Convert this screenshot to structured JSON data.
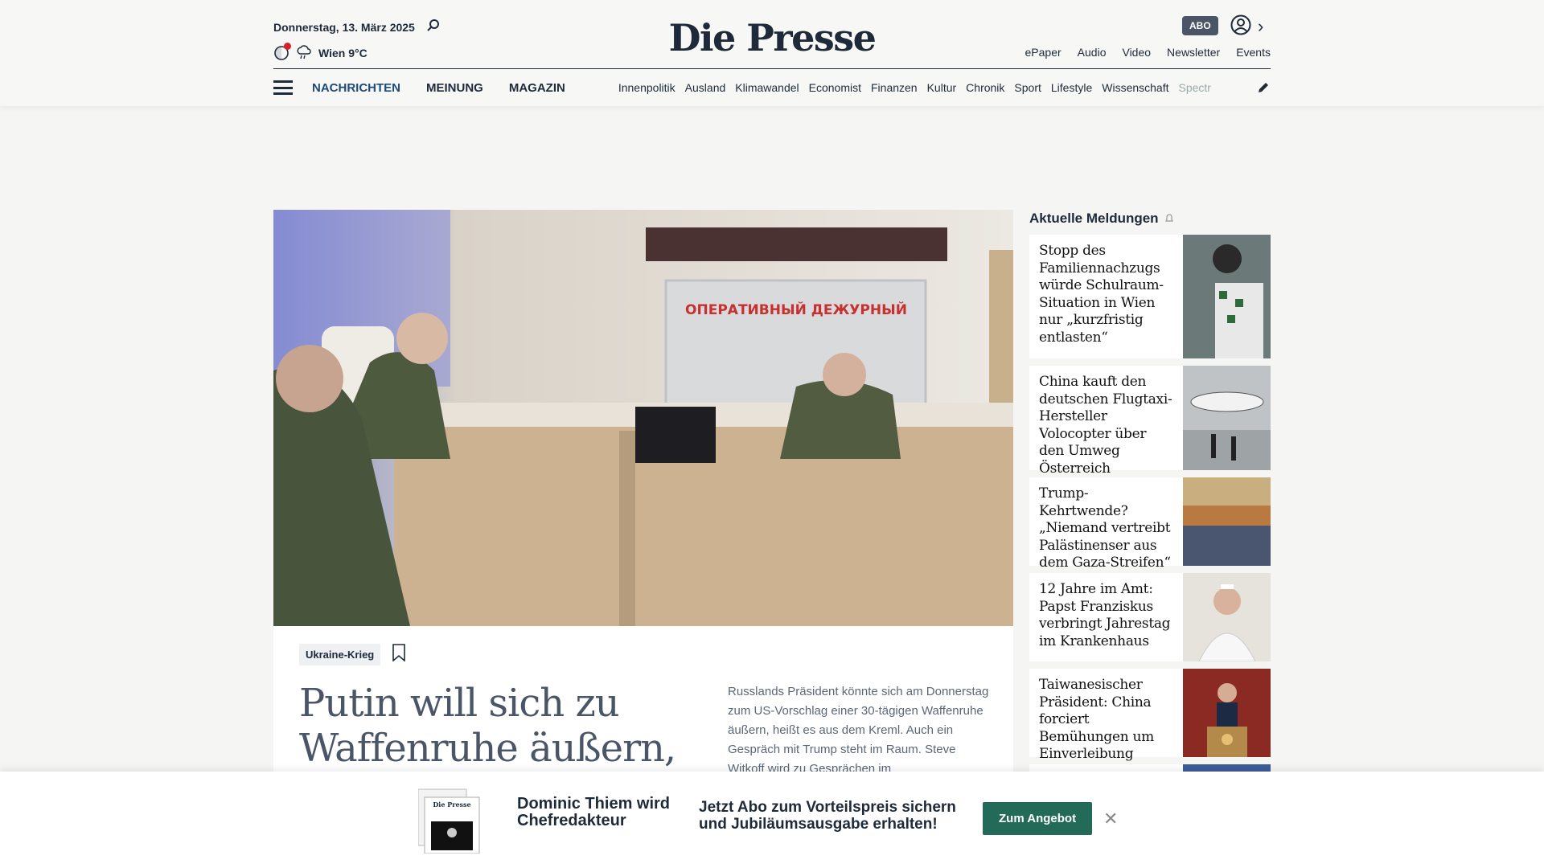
{
  "header": {
    "date": "Donnerstag, 13. März 2025",
    "weather": "Wien 9°C",
    "logo": "Die Presse",
    "abo_label": "ABO",
    "top_links": [
      "ePaper",
      "Audio",
      "Video",
      "Newsletter",
      "Events"
    ]
  },
  "nav": {
    "main": [
      "NACHRICHTEN",
      "MEINUNG",
      "MAGAZIN"
    ],
    "sub": [
      "Innenpolitik",
      "Ausland",
      "Klimawandel",
      "Economist",
      "Finanzen",
      "Kultur",
      "Chronik",
      "Sport",
      "Lifestyle",
      "Wissenschaft",
      "Spectr"
    ]
  },
  "article": {
    "tag": "Ukraine-Krieg",
    "headline": "Putin will sich zu Waffenruhe äußern, US-",
    "lead": "Russlands Präsident könnte sich am Donnerstag zum US-Vorschlag einer 30-tägigen Waffenruhe äußern, heißt es aus dem Kreml. Auch ein Gespräch mit Trump steht im Raum. Steve Witkoff wird zu Gesprächen im",
    "photo_sign": "ОПЕРАТИВНЫЙ  ДЕЖУРНЫЙ"
  },
  "sidebar": {
    "title": "Aktuelle Meldungen",
    "items": [
      {
        "text": "Stopp des Familiennachzugs würde Schulraum-Situation in Wien nur „kurzfristig entlasten“"
      },
      {
        "text": "China kauft den deutschen Flugtaxi-Hersteller Volocopter über den Umweg Österreich"
      },
      {
        "text": "Trump-Kehrtwende? „Niemand vertreibt Palästinenser aus dem Gaza-Streifen“"
      },
      {
        "text": "12 Jahre im Amt: Papst Franziskus verbringt Jahrestag im Krankenhaus"
      },
      {
        "text": "Taiwanesischer Präsident: China forciert Bemühungen um Einverleibung"
      }
    ]
  },
  "banner": {
    "name": "Dominic Thiem wird Chefredakteur",
    "offer": "Jetzt Abo zum Vorteilspreis sichern und Jubiläumsausgabe erhalten!",
    "button": "Zum Angebot",
    "thumb_logo": "Die Presse"
  },
  "colors": {
    "navy": "#1e2a3a",
    "accent_blue": "#1d4a7a",
    "cta_green": "#236b58",
    "red_dot": "#d6202a"
  }
}
